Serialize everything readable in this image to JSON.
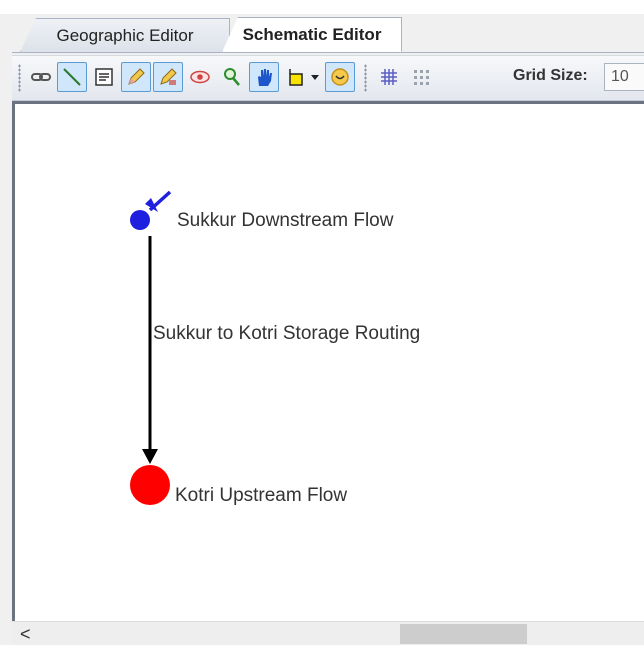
{
  "tabs": [
    {
      "label": "Geographic Editor",
      "active": false
    },
    {
      "label": "Schematic Editor",
      "active": true
    }
  ],
  "toolbar": {
    "buttons": [
      {
        "icon": "link-icon"
      },
      {
        "icon": "draw-line-icon",
        "active": true
      },
      {
        "icon": "text-note-icon"
      },
      {
        "icon": "pencil-edit-icon",
        "active": true
      },
      {
        "icon": "pencil-delete-icon",
        "active": true
      },
      {
        "icon": "eye-icon"
      },
      {
        "icon": "zoom-icon"
      },
      {
        "icon": "hand-pan-icon",
        "active": true
      },
      {
        "icon": "node-shape-icon"
      },
      {
        "icon": "node-dropdown-icon"
      },
      {
        "icon": "layer-icon",
        "active": true
      },
      {
        "icon": "grid-icon"
      },
      {
        "icon": "snap-grid-icon"
      }
    ],
    "grid_size_label": "Grid Size:",
    "grid_size_value": "10"
  },
  "diagram": {
    "nodes": [
      {
        "label": "Sukkur Downstream Flow",
        "color": "#1f1fe0",
        "shape": "small-circle"
      },
      {
        "label": "Kotri Upstream Flow",
        "color": "#ff0000",
        "shape": "large-circle"
      }
    ],
    "links": [
      {
        "label": "Sukkur to Kotri Storage Routing",
        "from": "Sukkur Downstream Flow",
        "to": "Kotri Upstream Flow"
      }
    ]
  },
  "scrollbar": {
    "left_arrow": "<"
  }
}
